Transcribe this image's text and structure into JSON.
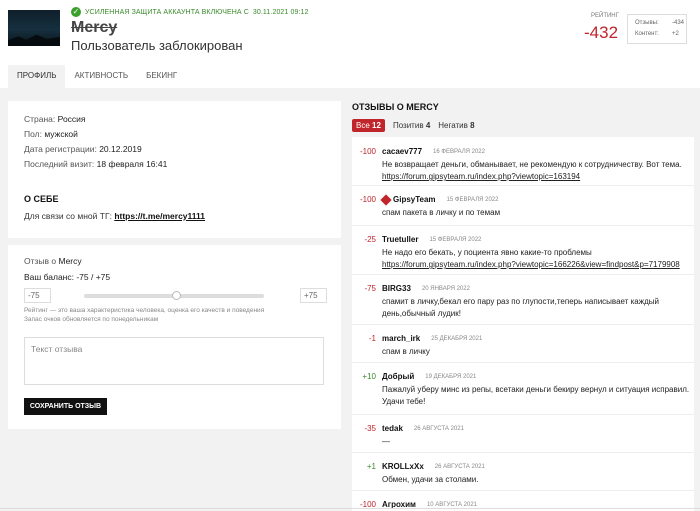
{
  "profile": {
    "security_notice": "Усиленная защита аккаунта включена с",
    "security_date": "30.11.2021 09:12",
    "username": "Mercy",
    "status": "Пользователь заблокирован"
  },
  "rating": {
    "label": "Рейтинг",
    "value": "-432",
    "feedback_label": "Отзывы:",
    "feedback_value": "-434",
    "content_label": "Контент:",
    "content_value": "+2"
  },
  "tabs": [
    "Профиль",
    "Активность",
    "Бекинг"
  ],
  "info": {
    "country_label": "Страна:",
    "country": "Россия",
    "gender_label": "Пол:",
    "gender": "мужской",
    "reg_label": "Дата регистрации:",
    "reg": "20.12.2019",
    "visit_label": "Последний визит:",
    "visit": "18 февраля 16:41"
  },
  "about": {
    "heading": "О себе",
    "text": "Для связи со мной ТГ:",
    "link": "https://t.me/mercy1111"
  },
  "feedback_form": {
    "title_prefix": "Отзыв о",
    "title_user": "Mercy",
    "balance": "Ваш баланс: -75 / +75",
    "min": "-75",
    "max": "+75",
    "hint1": "Рейтинг — это ваша характеристика человека, оценка его качеств и поведения",
    "hint2": "Запас очков обновляется по понедельникам",
    "placeholder": "Текст отзыва",
    "save_label": "Сохранить отзыв"
  },
  "reviews": {
    "heading": "Отзывы о Mercy",
    "filters": [
      {
        "label": "Все",
        "count": "12"
      },
      {
        "label": "Позитив",
        "count": "4"
      },
      {
        "label": "Негатив",
        "count": "8"
      }
    ],
    "items": [
      {
        "score": "-100",
        "author": "cacaev777",
        "date": "16 февраля 2022",
        "text": "Не возвращает деньги, обманывает, не рекомендую к сотрудничеству. Вот тема.",
        "link": "https://forum.gipsyteam.ru/index.php?viewtopic=163194"
      },
      {
        "score": "-100",
        "author": "GipsyTeam",
        "date": "15 февраля 2022",
        "text": "спам пакета в личку и по темам",
        "link": ""
      },
      {
        "score": "-25",
        "author": "Truetuller",
        "date": "15 февраля 2022",
        "text": "Не надо его бекать, у поциента явно какие-то проблемы",
        "link": "https://forum.gipsyteam.ru/index.php?viewtopic=166226&view=findpost&p=7179908"
      },
      {
        "score": "-75",
        "author": "BIRG33",
        "date": "20 января 2022",
        "text": "спамит в личку,бекал его пару раз по глупости,теперь написывает каждый день,обычный лудик!",
        "link": ""
      },
      {
        "score": "-1",
        "author": "march_irk",
        "date": "25 декабря 2021",
        "text": "спам в личку",
        "link": ""
      },
      {
        "score": "+10",
        "author": "Добрый",
        "date": "19 декабря 2021",
        "text": "Пажалуй уберу минс из репы, всетаки деньги бекиру вернул и ситуация исправил. Удачи тебе!",
        "link": ""
      },
      {
        "score": "-35",
        "author": "tedak",
        "date": "26 августа 2021",
        "text": "—",
        "link": ""
      },
      {
        "score": "+1",
        "author": "KROLLxXx",
        "date": "26 августа 2021",
        "text": "Обмен, удачи за столами.",
        "link": ""
      },
      {
        "score": "-100",
        "author": "Агрохим",
        "date": "10 августа 2021",
        "text": "",
        "link": ""
      }
    ]
  }
}
